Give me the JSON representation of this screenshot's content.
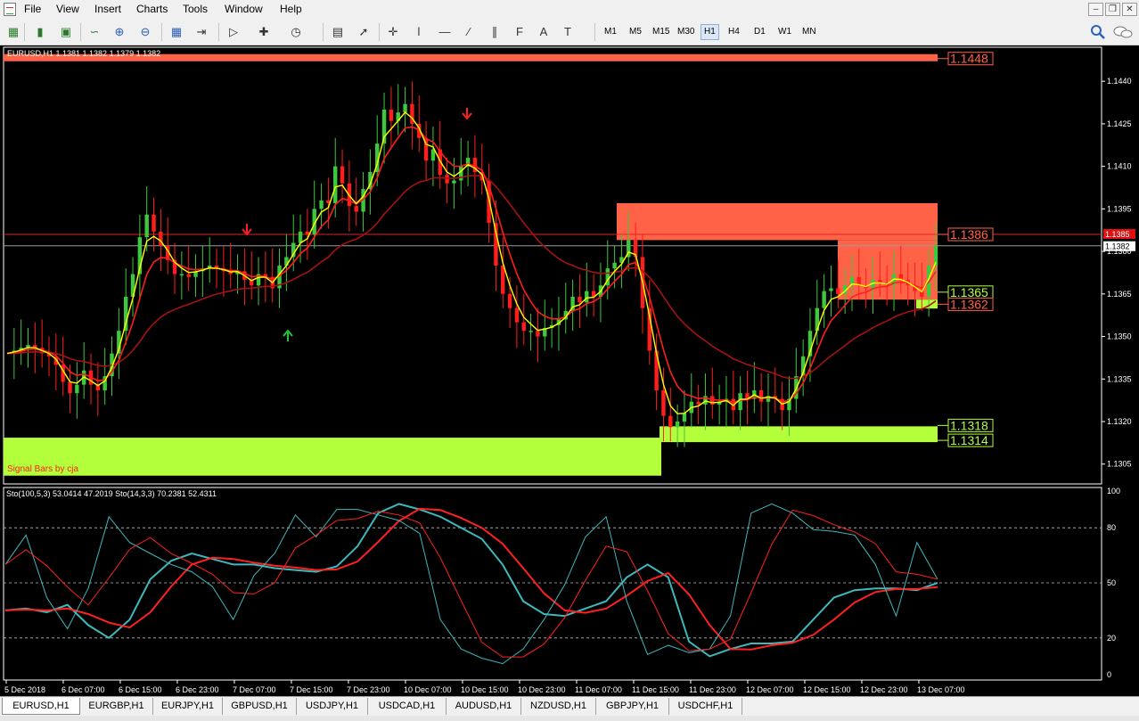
{
  "menu": {
    "items": [
      "File",
      "View",
      "Insert",
      "Charts",
      "Tools",
      "Window",
      "Help"
    ]
  },
  "toolbar": {
    "tool_icons": [
      "new-chart-icon",
      "bar-chart-icon",
      "candlestick-icon",
      "line-chart-icon",
      "zoom-in-icon",
      "zoom-out-icon",
      "tile-windows-icon",
      "chart-shift-icon",
      "autoscroll-icon",
      "indicators-icon",
      "periods-icon",
      "templates-icon",
      "cursor-icon",
      "crosshair-icon",
      "vertical-line-icon",
      "horizontal-line-icon",
      "trendline-icon",
      "channel-icon",
      "fibonacci-icon",
      "text-icon",
      "text-label-icon",
      "arrows-icon"
    ],
    "timeframes": [
      "M1",
      "M5",
      "M15",
      "M30",
      "H1",
      "H4",
      "D1",
      "W1",
      "MN"
    ],
    "active_timeframe": "H1"
  },
  "chart": {
    "symbol_info": "EURUSD,H1  1.1381 1.1382 1.1379 1.1382",
    "signal_label": "Signal Bars by cja",
    "indicator_label": "Sto(100,5,3) 53.0414 47.2019  Sto(14,3,3) 70.2381 52.4311",
    "price_tag_current": "1.1382",
    "price_tag_bid": "1.1385",
    "level_labels": [
      "1.1448",
      "1.1386",
      "1.1365",
      "1.1362",
      "1.1318",
      "1.1314"
    ],
    "colors": {
      "bull": "#3ec83e",
      "bear": "#ff1e1e",
      "zone_red": "#ff6247",
      "zone_green": "#b4ff3c",
      "ema_fast": "#ffff00",
      "ema_mid": "#ff1e1e",
      "ema_slow": "#a41212",
      "sto_fast": "#3fb8bc",
      "sto_slow": "#ff2020"
    }
  },
  "chart_data": {
    "type": "candlestick",
    "price_axis": {
      "ylim": [
        1.1298,
        1.1452
      ],
      "ticks": [
        "1.1440",
        "1.1425",
        "1.1410",
        "1.1395",
        "1.1380",
        "1.1365",
        "1.1350",
        "1.1335",
        "1.1320",
        "1.1305"
      ]
    },
    "time_axis": [
      "5 Dec 2018",
      "6 Dec 07:00",
      "6 Dec 15:00",
      "6 Dec 23:00",
      "7 Dec 07:00",
      "7 Dec 15:00",
      "7 Dec 23:00",
      "10 Dec 07:00",
      "10 Dec 15:00",
      "10 Dec 23:00",
      "11 Dec 07:00",
      "11 Dec 15:00",
      "11 Dec 23:00",
      "12 Dec 07:00",
      "12 Dec 15:00",
      "12 Dec 23:00",
      "13 Dec 07:00"
    ],
    "close_path": [
      1.1344,
      1.1345,
      1.1346,
      1.1347,
      1.1346,
      1.1344,
      1.1343,
      1.134,
      1.1334,
      1.133,
      1.1333,
      1.1338,
      1.1333,
      1.1331,
      1.1336,
      1.1344,
      1.1352,
      1.1364,
      1.1372,
      1.1385,
      1.1393,
      1.1387,
      1.1382,
      1.1377,
      1.1372,
      1.1372,
      1.1371,
      1.1373,
      1.1374,
      1.1375,
      1.1374,
      1.1373,
      1.1372,
      1.1373,
      1.137,
      1.1368,
      1.1372,
      1.1371,
      1.1367,
      1.1375,
      1.1378,
      1.1383,
      1.1387,
      1.1386,
      1.1395,
      1.1398,
      1.1397,
      1.141,
      1.1404,
      1.1396,
      1.1394,
      1.1402,
      1.1408,
      1.1418,
      1.143,
      1.1426,
      1.1429,
      1.1432,
      1.1425,
      1.142,
      1.1412,
      1.1416,
      1.1407,
      1.1404,
      1.1405,
      1.141,
      1.1413,
      1.1408,
      1.1405,
      1.139,
      1.1375,
      1.1365,
      1.136,
      1.1355,
      1.1352,
      1.1352,
      1.135,
      1.1353,
      1.1354,
      1.1356,
      1.1359,
      1.1364,
      1.1362,
      1.1366,
      1.1364,
      1.1368,
      1.1374,
      1.1376,
      1.1378,
      1.1384,
      1.1378,
      1.136,
      1.1345,
      1.1331,
      1.1322,
      1.1318,
      1.132,
      1.1323,
      1.1327,
      1.1326,
      1.1329,
      1.1326,
      1.1327,
      1.1328,
      1.1324,
      1.133,
      1.1328,
      1.1331,
      1.1327,
      1.1329,
      1.1328,
      1.1324,
      1.1328,
      1.1336,
      1.1343,
      1.1352,
      1.136,
      1.1366,
      1.1367,
      1.1365,
      1.1368,
      1.1371,
      1.1368,
      1.1367,
      1.137,
      1.1369,
      1.1368,
      1.1372,
      1.137,
      1.1368,
      1.1366,
      1.1364,
      1.1375,
      1.1382
    ],
    "levels": [
      1.1448,
      1.1386,
      1.1365,
      1.1362,
      1.1318,
      1.1314
    ],
    "signal_arrows": [
      {
        "type": "sell",
        "date": "7 Dec 02:00"
      },
      {
        "type": "buy",
        "date": "7 Dec 15:00"
      },
      {
        "type": "sell",
        "date": "10 Dec 11:00"
      }
    ],
    "stochastic": {
      "ylim": [
        0,
        100
      ],
      "ticks": [
        "100",
        "80",
        "50",
        "20",
        "0"
      ],
      "levels": [
        80,
        50,
        20
      ],
      "series": [
        {
          "name": "Sto(100,5,3)",
          "values": [
            35,
            36,
            34,
            38,
            27,
            20,
            30,
            52,
            62,
            66,
            63,
            60,
            60,
            58,
            57,
            56,
            59,
            70,
            88,
            93,
            90,
            86,
            80,
            74,
            60,
            40,
            33,
            32,
            36,
            40,
            53,
            60,
            53,
            18,
            10,
            14,
            17,
            17,
            18,
            30,
            42,
            46,
            47,
            47,
            46,
            50
          ]
        },
        {
          "name": "Sto(14,3,3)",
          "values": [
            60,
            76,
            42,
            25,
            47,
            86,
            72,
            66,
            60,
            56,
            48,
            30,
            54,
            66,
            87,
            75,
            90,
            90,
            87,
            84,
            77,
            30,
            14,
            9,
            6,
            14,
            30,
            49,
            75,
            86,
            40,
            11,
            16,
            12,
            14,
            32,
            88,
            93,
            88,
            79,
            78,
            76,
            60,
            32,
            72,
            52
          ]
        }
      ]
    }
  },
  "tabs": [
    "EURUSD,H1",
    "EURGBP,H1",
    "EURJPY,H1",
    "GBPUSD,H1",
    "USDJPY,H1",
    "USDCAD,H1",
    "AUDUSD,H1",
    "NZDUSD,H1",
    "GBPJPY,H1",
    "USDCHF,H1"
  ],
  "active_tab": "EURUSD,H1"
}
